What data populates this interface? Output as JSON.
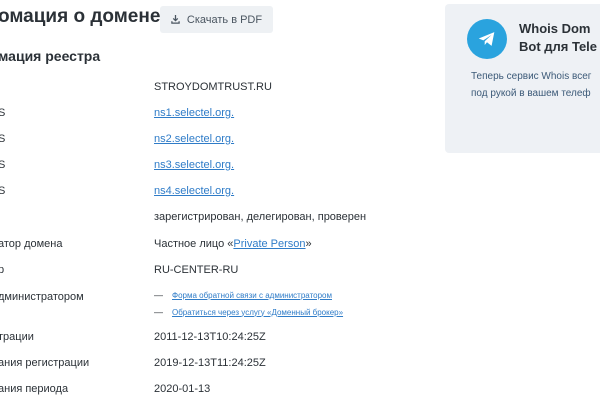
{
  "header": {
    "title": "омация о домене",
    "pdf_button_label": "Скачать в PDF"
  },
  "registry": {
    "section_title": "мация реестра",
    "rows": [
      {
        "label": "",
        "value": "STROYDOMTRUST.RU"
      },
      {
        "label": "S",
        "value": "ns1.selectel.org."
      },
      {
        "label": "S",
        "value": "ns2.selectel.org."
      },
      {
        "label": "S",
        "value": "ns3.selectel.org."
      },
      {
        "label": "S",
        "value": "ns4.selectel.org."
      },
      {
        "label": "",
        "value": "зарегистрирован, делегирован, проверен"
      },
      {
        "label": "атор домена",
        "value_prefix": "Частное лицо «",
        "value_link": "Private Person",
        "value_suffix": "»"
      },
      {
        "label": "р",
        "value": "RU-CENTER-RU"
      },
      {
        "label": "дминистратором",
        "links": [
          "Форма обратной связи с администратором",
          "Обратиться через услугу «Доменный брокер»"
        ],
        "dash": "—"
      },
      {
        "label": "трации",
        "value": "2011-12-13T10:24:25Z"
      },
      {
        "label": "ания регистрации",
        "value": "2019-12-13T11:24:25Z"
      },
      {
        "label": "ания периода",
        "value": "2020-01-13"
      }
    ]
  },
  "promo": {
    "title_line1": "Whois Dom",
    "title_line2": "Bot для Tele",
    "text_line1": "Теперь сервис Whois всег",
    "text_line2": "под рукой в вашем телеф",
    "icon": "telegram-icon",
    "icon_color": "#2aa3de"
  }
}
